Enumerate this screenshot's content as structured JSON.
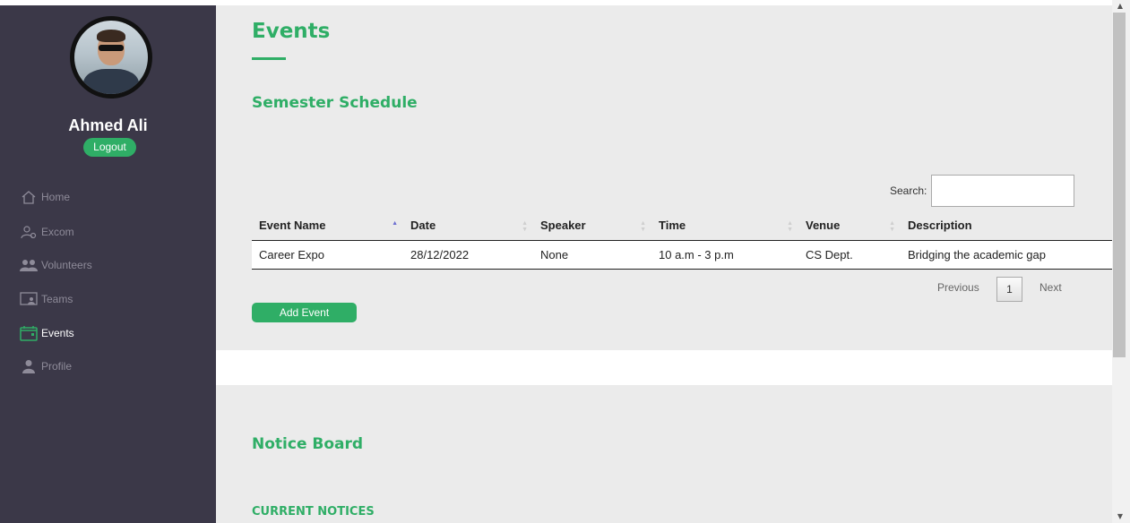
{
  "user": {
    "name": "Ahmed Ali",
    "logout_label": "Logout"
  },
  "nav": {
    "items": [
      {
        "label": "Home",
        "icon": "home-icon",
        "active": false
      },
      {
        "label": "Excom",
        "icon": "users-gear-icon",
        "active": false
      },
      {
        "label": "Volunteers",
        "icon": "group-icon",
        "active": false
      },
      {
        "label": "Teams",
        "icon": "presentation-icon",
        "active": false
      },
      {
        "label": "Events",
        "icon": "calendar-icon",
        "active": true
      },
      {
        "label": "Profile",
        "icon": "person-icon",
        "active": false
      }
    ]
  },
  "page": {
    "title": "Events",
    "schedule_heading": "Semester Schedule",
    "notice_heading": "Notice Board",
    "current_notices_heading": "CURRENT NOTICES"
  },
  "table": {
    "search_label": "Search:",
    "search_value": "",
    "columns": [
      "Event Name",
      "Date",
      "Speaker",
      "Time",
      "Venue",
      "Description"
    ],
    "rows": [
      [
        "Career Expo",
        "28/12/2022",
        "None",
        "10 a.m - 3 p.m",
        "CS Dept.",
        "Bridging the academic gap"
      ]
    ]
  },
  "pagination": {
    "previous_label": "Previous",
    "current_page": "1",
    "next_label": "Next"
  },
  "actions": {
    "add_event_label": "Add Event"
  },
  "colors": {
    "accent": "#2fae66",
    "sidebar": "#3b3848",
    "sort_active": "#6d6fd1"
  }
}
